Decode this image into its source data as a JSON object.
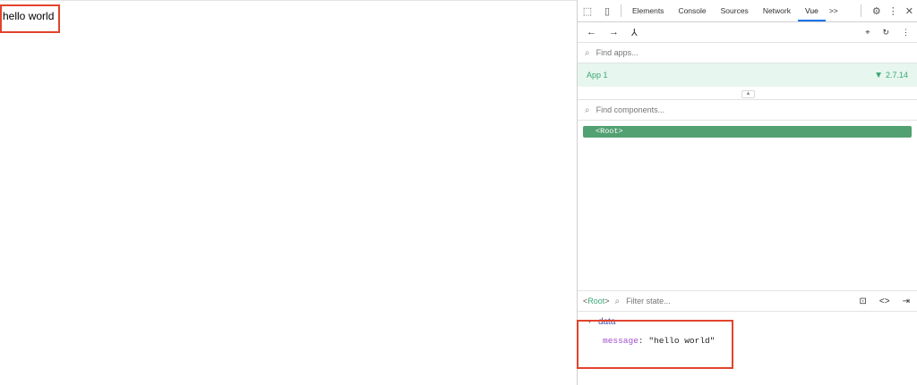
{
  "page": {
    "text": "hello world"
  },
  "devtools": {
    "tabs": [
      "Elements",
      "Console",
      "Sources",
      "Network",
      "Vue"
    ],
    "more": ">>",
    "apps_search_placeholder": "Find apps...",
    "app": {
      "name": "App 1",
      "version": "2.7.14"
    },
    "components_search_placeholder": "Find components...",
    "root_component": "<Root>",
    "state_bar": {
      "root_label": "Root",
      "filter_placeholder": "Filter state..."
    },
    "state": {
      "section": "data",
      "key": "message",
      "value": "\"hello world\""
    }
  },
  "colors": {
    "highlight_border": "#e2432d",
    "vue_green": "#3ba776",
    "root_bg": "#52a172",
    "app_row_bg": "#e7f6ee"
  }
}
